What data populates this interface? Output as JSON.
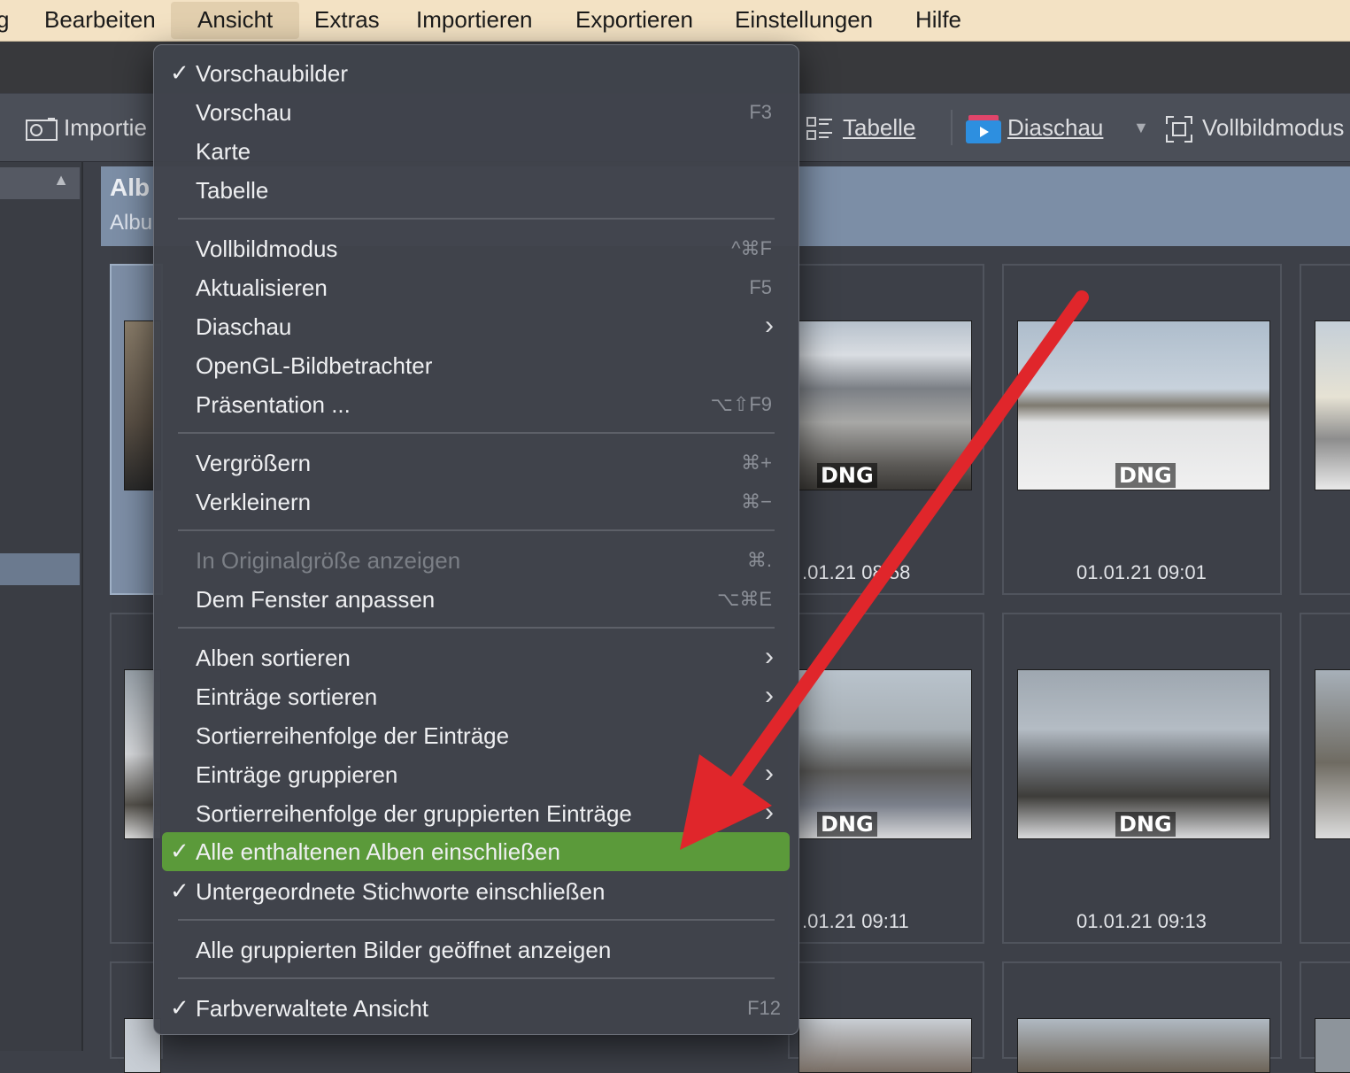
{
  "menubar": {
    "items": [
      "g",
      "Bearbeiten",
      "Ansicht",
      "Extras",
      "Importieren",
      "Exportieren",
      "Einstellungen",
      "Hilfe"
    ]
  },
  "toolbar": {
    "import_label": "Importie",
    "table_label": "Tabelle",
    "slideshow_label": "Diaschau",
    "fullscreen_label": "Vollbildmodus"
  },
  "album_header": {
    "title": "Alb",
    "subtitle": "Albu"
  },
  "grid": {
    "badge": "DNG",
    "timestamps": [
      ".01.21 08:58",
      "01.01.21 09:01",
      ".01.21 09:11",
      "01.01.21 09:13"
    ]
  },
  "menu": {
    "items": [
      {
        "label": "Vorschaubilder",
        "checked": true,
        "shortcut": ""
      },
      {
        "label": "Vorschau",
        "shortcut": "F3"
      },
      {
        "label": "Karte",
        "shortcut": ""
      },
      {
        "label": "Tabelle",
        "shortcut": ""
      },
      {
        "label": "Vollbildmodus",
        "shortcut": "^⌘F"
      },
      {
        "label": "Aktualisieren",
        "shortcut": "F5"
      },
      {
        "label": "Diaschau",
        "submenu": true
      },
      {
        "label": "OpenGL-Bildbetrachter",
        "shortcut": ""
      },
      {
        "label": "Präsentation ...",
        "shortcut": "⌥⇧F9"
      },
      {
        "label": "Vergrößern",
        "shortcut": "⌘+"
      },
      {
        "label": "Verkleinern",
        "shortcut": "⌘−"
      },
      {
        "label": "In Originalgröße anzeigen",
        "shortcut": "⌘.",
        "disabled": true
      },
      {
        "label": "Dem Fenster anpassen",
        "shortcut": "⌥⌘E"
      },
      {
        "label": "Alben sortieren",
        "submenu": true
      },
      {
        "label": "Einträge sortieren",
        "submenu": true
      },
      {
        "label": "Sortierreihenfolge der Einträge",
        "shortcut": ""
      },
      {
        "label": "Einträge gruppieren",
        "submenu": true
      },
      {
        "label": "Sortierreihenfolge der gruppierten Einträge",
        "submenu": true
      },
      {
        "label": "Alle enthaltenen Alben einschließen",
        "checked": true,
        "highlighted": true
      },
      {
        "label": "Untergeordnete Stichworte einschließen",
        "checked": true
      },
      {
        "label": "Alle gruppierten Bilder geöffnet anzeigen",
        "shortcut": ""
      },
      {
        "label": "Farbverwaltete Ansicht",
        "checked": true,
        "shortcut": "F12"
      }
    ],
    "check_glyph": "✓",
    "submenu_glyph": "›"
  },
  "colors": {
    "menubar_bg": "#f3e2c4",
    "menu_bg": "#40434b",
    "highlight": "#5b9a3a",
    "arrow": "#e0262b",
    "selection": "#7d8ea6"
  }
}
